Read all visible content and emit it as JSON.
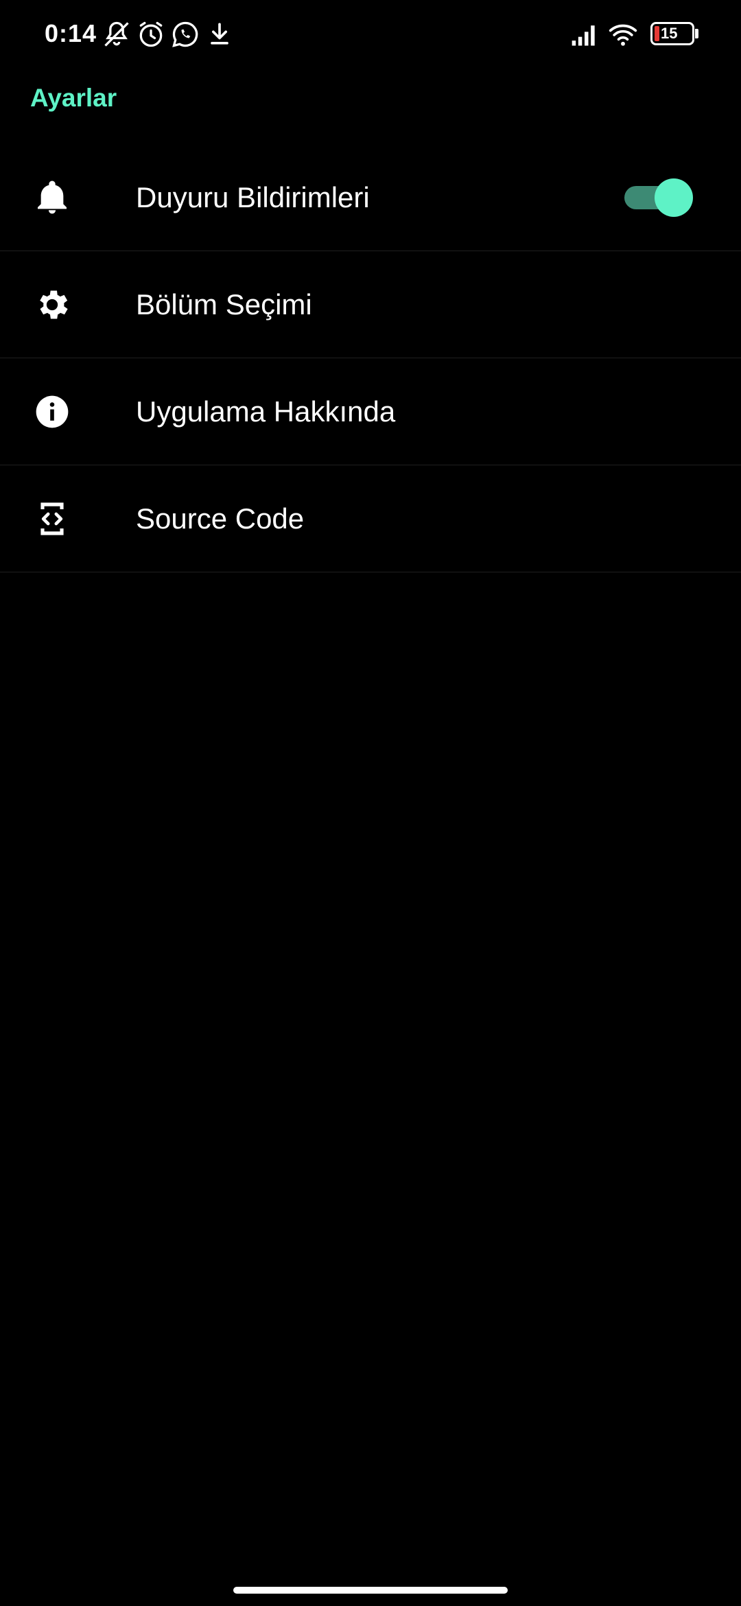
{
  "status_bar": {
    "time": "0:14",
    "battery_level": "15",
    "icons": [
      "muted-bell-icon",
      "alarm-icon",
      "whatsapp-icon",
      "download-icon",
      "signal-icon",
      "wifi-icon",
      "battery-icon"
    ]
  },
  "header": {
    "title": "Ayarlar"
  },
  "settings": {
    "items": [
      {
        "label": "Duyuru Bildirimleri",
        "icon": "bell-icon",
        "toggle": true,
        "toggle_on": true
      },
      {
        "label": "Bölüm Seçimi",
        "icon": "gear-icon"
      },
      {
        "label": "Uygulama Hakkında",
        "icon": "info-icon"
      },
      {
        "label": "Source Code",
        "icon": "source-code-icon"
      }
    ]
  },
  "colors": {
    "accent": "#5ef2c6",
    "toggle_track": "#3d8a74",
    "background": "#000000",
    "text": "#ffffff",
    "divider": "#1f1f1f",
    "battery_low": "#e53935"
  }
}
